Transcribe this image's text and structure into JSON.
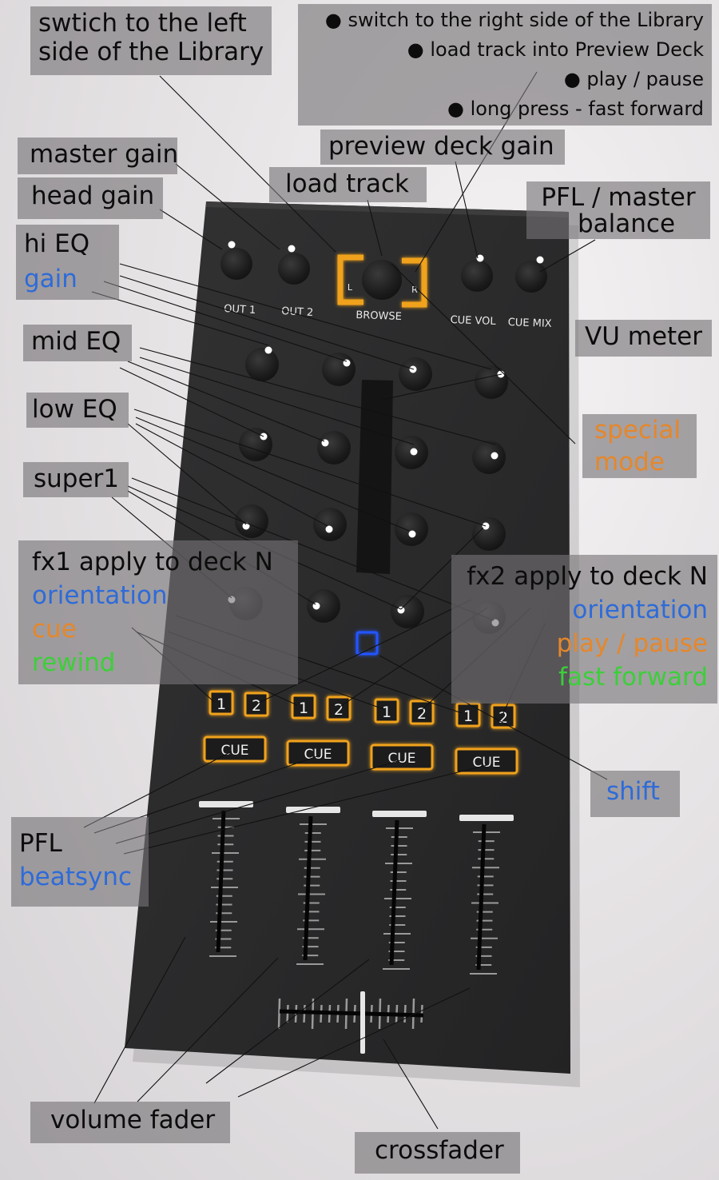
{
  "colors": {
    "accent_orange": "#f0a21e",
    "blue_highlight": "#2e6bd8",
    "orange_text": "#e5872b",
    "green_text": "#3ccf3a",
    "panel": "#2a2a2b"
  },
  "panel_text": {
    "out1": "OUT 1",
    "out2": "OUT 2",
    "browse": "BROWSE",
    "browse_left": "L",
    "browse_right": "R",
    "cue_vol": "CUE VOL",
    "cue_mix": "CUE MIX",
    "fx_one": "1",
    "fx_two": "2",
    "cue": "CUE"
  },
  "labels": {
    "left_library": [
      "swtich to the left",
      "side of the Library"
    ],
    "right_library": [
      "● switch to the right side of the Library",
      "● load track into Preview Deck",
      "● play / pause",
      "● long press - fast forward"
    ],
    "preview_gain": "preview deck gain",
    "master_gain": "master gain",
    "head_gain": "head gain",
    "load_track": "load track",
    "pfl_balance": [
      "PFL / master",
      "balance"
    ],
    "hi_eq": "hi EQ",
    "gain": "gain",
    "mid_eq": "mid EQ",
    "vu_meter": "VU meter",
    "low_eq": "low EQ",
    "special_mode": [
      "special",
      "mode"
    ],
    "super1": "super1",
    "fx1": {
      "title": "fx1 apply to deck N",
      "orientation": "orientation",
      "cue": "cue",
      "rewind": "rewind"
    },
    "fx2": {
      "title": "fx2 apply to deck N",
      "orientation": "orientation",
      "play_pause": "play / pause",
      "fast_forward": "fast forward"
    },
    "shift": "shift",
    "pfl": "PFL",
    "beatsync": "beatsync",
    "volume_fader": "volume fader",
    "crossfader": "crossfader"
  }
}
